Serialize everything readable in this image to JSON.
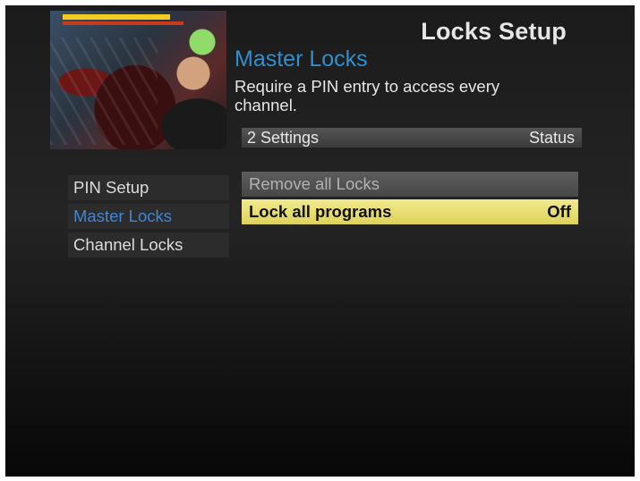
{
  "screen_title": "Locks Setup",
  "section": {
    "title": "Master Locks",
    "description": "Require a PIN entry to access every channel."
  },
  "settings_header": {
    "count": "2 Settings",
    "status": "Status"
  },
  "menu": {
    "items": [
      {
        "label": "PIN Setup"
      },
      {
        "label": "Master Locks"
      },
      {
        "label": "Channel Locks"
      }
    ],
    "active_index": 1
  },
  "options": [
    {
      "label": "Remove all Locks",
      "value": "",
      "state": "disabled"
    },
    {
      "label": "Lock all programs",
      "value": "Off",
      "state": "selected"
    }
  ],
  "colors": {
    "accent": "#2f8fcf",
    "highlight": "#e8df72",
    "background": "#1f1f1f"
  }
}
